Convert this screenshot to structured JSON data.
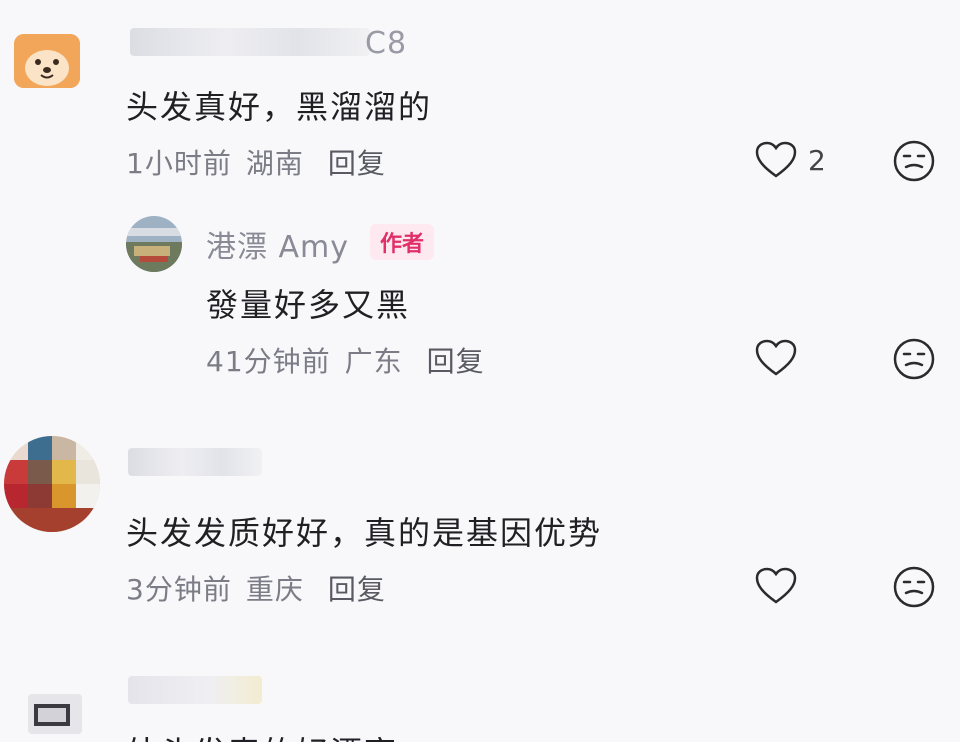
{
  "comments": [
    {
      "username_suffix": "C8",
      "text": "头发真好，黑溜溜的",
      "time": "1小时前",
      "location": "湖南",
      "reply_label": "回复",
      "likes": "2"
    },
    {
      "username": "港漂 Amy",
      "author_badge": "作者",
      "text": "發量好多又黑",
      "time": "41分钟前",
      "location": "广东",
      "reply_label": "回复"
    },
    {
      "text": "头发发质好好，真的是基因优势",
      "time": "3分钟前",
      "location": "重庆",
      "reply_label": "回复"
    },
    {
      "text": "外头发表的好漂亮"
    }
  ],
  "icons": {
    "like": "heart-outline-icon",
    "emoji": "neutral-face-icon"
  },
  "colors": {
    "background": "#f8f8fb",
    "badge_text": "#e0306a",
    "badge_bg": "#fde9ef"
  }
}
